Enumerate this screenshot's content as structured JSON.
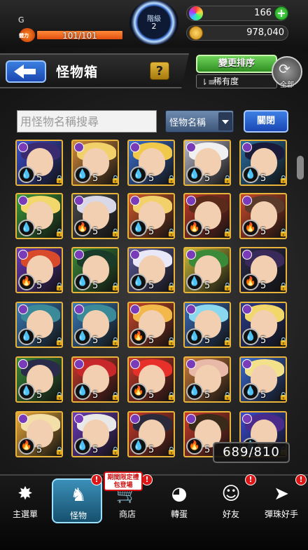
{
  "status": {
    "player_name": "G",
    "stamina_label": "體力",
    "stamina_text": "101/101",
    "stamina_fraction": 1.0,
    "rank_label": "階級",
    "rank_value": "2",
    "gems": "166",
    "gold": "978,040"
  },
  "header": {
    "title": "怪物箱",
    "help_label": "?",
    "sort_button": "變更排序",
    "sort_mode": "稀有度",
    "all_label": "全部"
  },
  "search": {
    "placeholder": "用怪物名稱搜尋",
    "filter_value": "怪物名稱",
    "close_label": "關閉"
  },
  "box": {
    "count": "689/810",
    "monsters": [
      {
        "level": "5",
        "element": "water",
        "bg": "#3b4fd0",
        "hair": "#3a2a70"
      },
      {
        "level": "5",
        "element": "water",
        "bg": "#d28a3a",
        "hair": "#f2d06a"
      },
      {
        "level": "5",
        "element": "water",
        "bg": "#3b6fd0",
        "hair": "#f0c84a"
      },
      {
        "level": "5",
        "element": "water",
        "bg": "#b8b8c8",
        "hair": "#f0f0f0"
      },
      {
        "level": "5",
        "element": "water",
        "bg": "#2a6fa0",
        "hair": "#1a1a3a"
      },
      {
        "level": "5",
        "element": "water",
        "bg": "#3a9a3a",
        "hair": "#f2d86a"
      },
      {
        "level": "5",
        "element": "fire",
        "bg": "#4a4a4a",
        "hair": "#d8d8e8"
      },
      {
        "level": "5",
        "element": "water",
        "bg": "#d05a2a",
        "hair": "#f2d06a"
      },
      {
        "level": "5",
        "element": "fire",
        "bg": "#c03a2a",
        "hair": "#5a2a1a"
      },
      {
        "level": "5",
        "element": "fire",
        "bg": "#c8482a",
        "hair": "#5a3a2a"
      },
      {
        "level": "5",
        "element": "fire",
        "bg": "#6a3ab8",
        "hair": "#d84a2a"
      },
      {
        "level": "5",
        "element": "water",
        "bg": "#3a8a3a",
        "hair": "#1a3a2a"
      },
      {
        "level": "5",
        "element": "water",
        "bg": "#5a5a9a",
        "hair": "#e8e8f8"
      },
      {
        "level": "5",
        "element": "water",
        "bg": "#c8b83a",
        "hair": "#3a8a3a"
      },
      {
        "level": "5",
        "element": "fire",
        "bg": "#2a2a4a",
        "hair": "#3a2a5a"
      },
      {
        "level": "5",
        "element": "water",
        "bg": "#3a7ab8",
        "hair": "#3a8a9a"
      },
      {
        "level": "5",
        "element": "water",
        "bg": "#3a7ab8",
        "hair": "#3a8a9a"
      },
      {
        "level": "5",
        "element": "fire",
        "bg": "#c8482a",
        "hair": "#f2b84a"
      },
      {
        "level": "5",
        "element": "water",
        "bg": "#3a6ab8",
        "hair": "#8ad8f0"
      },
      {
        "level": "5",
        "element": "water",
        "bg": "#2a3a8a",
        "hair": "#f2d86a"
      },
      {
        "level": "5",
        "element": "water",
        "bg": "#3a8a3a",
        "hair": "#2a2a4a"
      },
      {
        "level": "5",
        "element": "water",
        "bg": "#c83a2a",
        "hair": "#c8282a"
      },
      {
        "level": "5",
        "element": "fire",
        "bg": "#c83a2a",
        "hair": "#e8302a"
      },
      {
        "level": "5",
        "element": "water",
        "bg": "#c87a3a",
        "hair": "#e8b8a8"
      },
      {
        "level": "5",
        "element": "water",
        "bg": "#3a6ad0",
        "hair": "#f2e08a"
      },
      {
        "level": "5",
        "element": "fire",
        "bg": "#e8a83a",
        "hair": "#f2e0a8"
      },
      {
        "level": "5",
        "element": "water",
        "bg": "#6a3ab8",
        "hair": "#e8e8e8"
      },
      {
        "level": "5",
        "element": "water",
        "bg": "#c83a2a",
        "hair": "#2a2a3a"
      },
      {
        "level": "5",
        "element": "fire",
        "bg": "#c83a2a",
        "hair": "#3a2a1a"
      },
      {
        "level": "5",
        "element": "water",
        "bg": "#3a4ad0",
        "hair": "#4a2a8a"
      }
    ]
  },
  "nav": [
    {
      "label": "主選單",
      "icon": "✸"
    },
    {
      "label": "怪物",
      "icon": "♞"
    },
    {
      "label": "商店",
      "icon": "🛒"
    },
    {
      "label": "轉蛋",
      "icon": "◕"
    },
    {
      "label": "好友",
      "icon": "☺"
    },
    {
      "label": "彈珠好手",
      "icon": "➤"
    }
  ],
  "promo_text": "期間限定禮包登場",
  "alert_text": "!",
  "lock_symbol": "🔒",
  "element_icons": {
    "water": "💧",
    "fire": "🔥"
  },
  "colors": {
    "accent_blue": "#1a47b4",
    "accent_green": "#2f8e22",
    "card_border": "#e8b33a",
    "alert_red": "#e01515"
  }
}
